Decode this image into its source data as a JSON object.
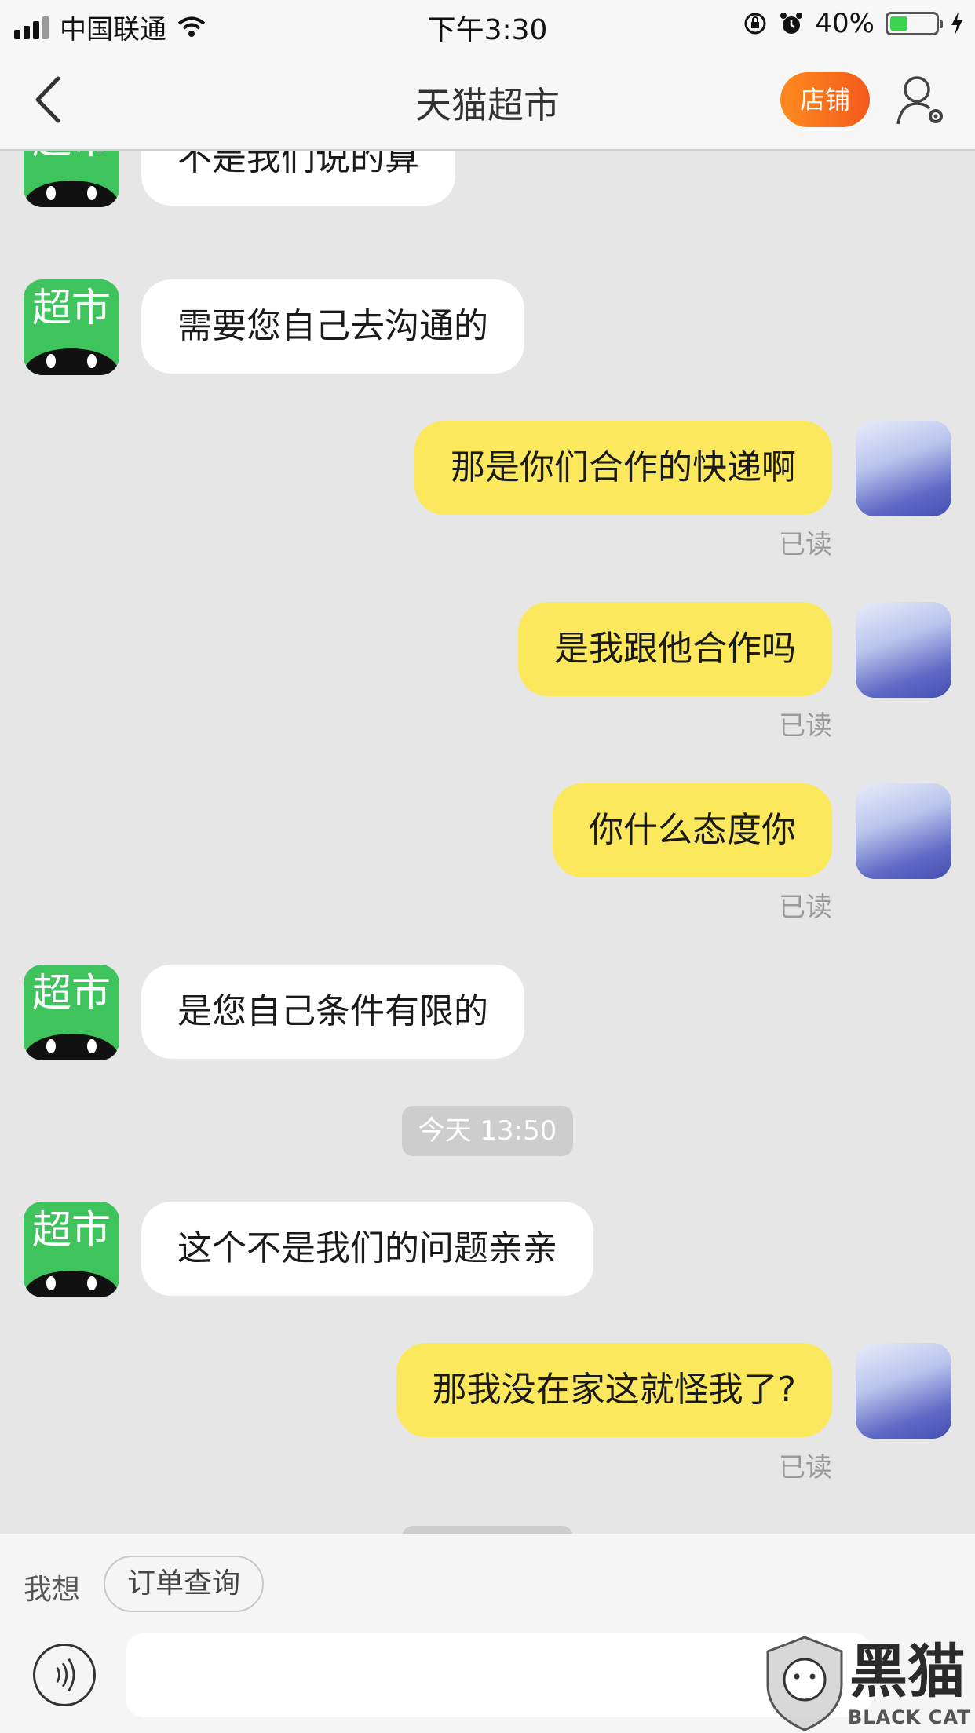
{
  "status_bar": {
    "carrier": "中国联通",
    "time": "下午3:30",
    "battery_percent": "40%",
    "battery_level": 0.4
  },
  "nav": {
    "title": "天猫超市",
    "shop_button": "店铺"
  },
  "bot_avatar_text": "超市",
  "messages": [
    {
      "side": "left",
      "text": "不是我们说的算"
    },
    {
      "side": "left",
      "text": "需要您自己去沟通的"
    },
    {
      "side": "right",
      "text": "那是你们合作的快递啊",
      "status": "已读"
    },
    {
      "side": "right",
      "text": "是我跟他合作吗",
      "status": "已读"
    },
    {
      "side": "right",
      "text": "你什么态度你",
      "status": "已读"
    },
    {
      "side": "left",
      "text": "是您自己条件有限的"
    },
    {
      "side": "time",
      "text": "今天 13:50"
    },
    {
      "side": "left",
      "text": "这个不是我们的问题亲亲"
    },
    {
      "side": "right",
      "text": "那我没在家这就怪我了?",
      "status": "已读"
    }
  ],
  "quick_bar": {
    "label": "我想",
    "chip": "订单查询"
  },
  "watermark": {
    "cn": "黑猫",
    "en": "BLACK CAT"
  }
}
